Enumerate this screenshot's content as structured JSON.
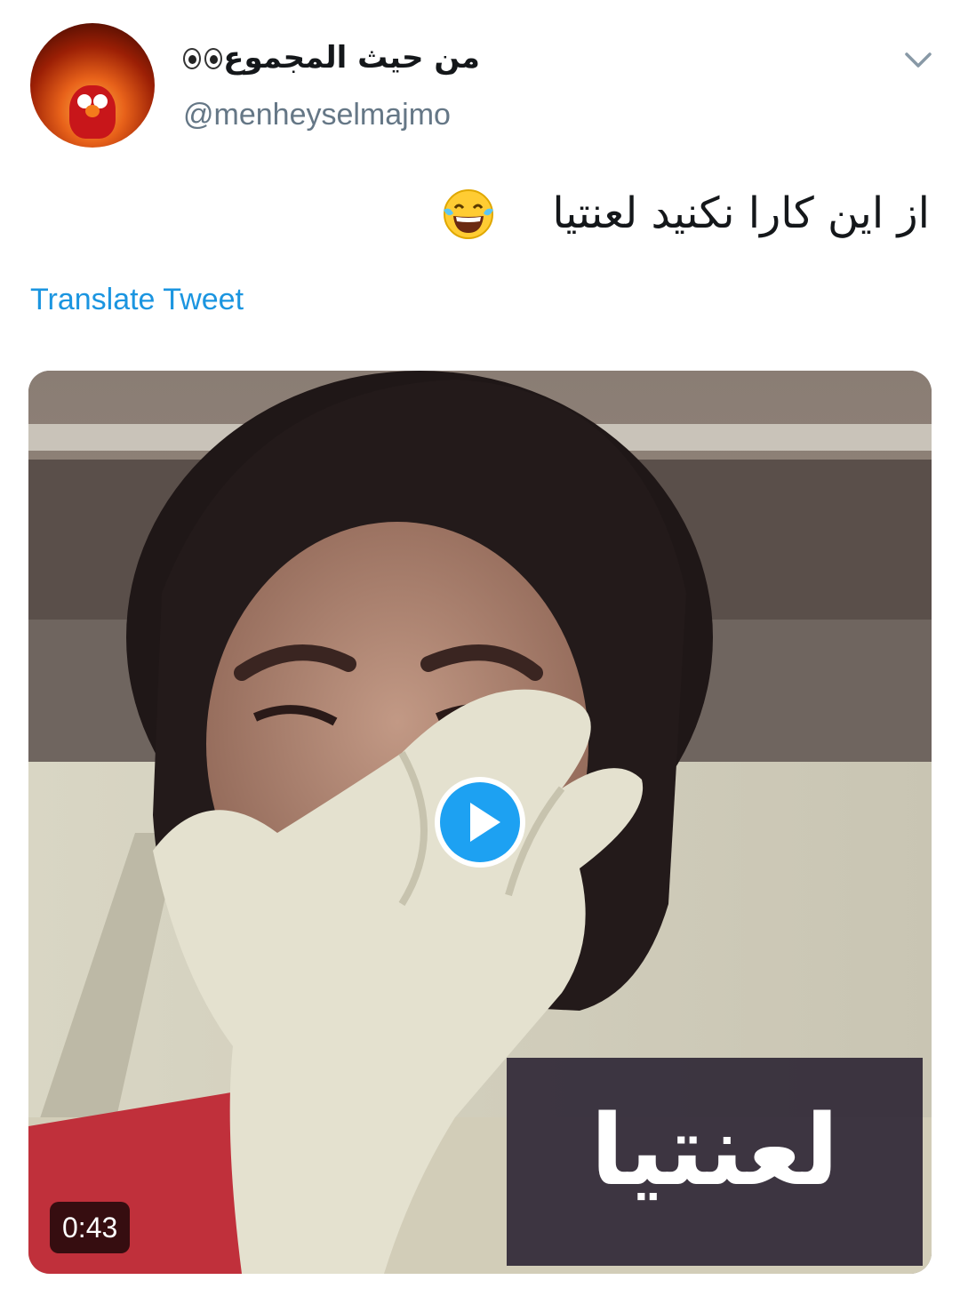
{
  "tweet": {
    "display_name": "من حيث المجموع",
    "display_name_emoji": "eyes-emoji",
    "handle": "@menheyselmajmo",
    "text": "از این کارا نکنید لعنتیا",
    "text_emoji": "face-with-tears-of-joy-emoji",
    "translate_label": "Translate Tweet"
  },
  "video": {
    "caption": "لعنتیا",
    "duration": "0:43",
    "play_icon": "play-icon"
  },
  "colors": {
    "link": "#1b95e0",
    "play_button": "#1da1f2",
    "handle": "#657786"
  }
}
